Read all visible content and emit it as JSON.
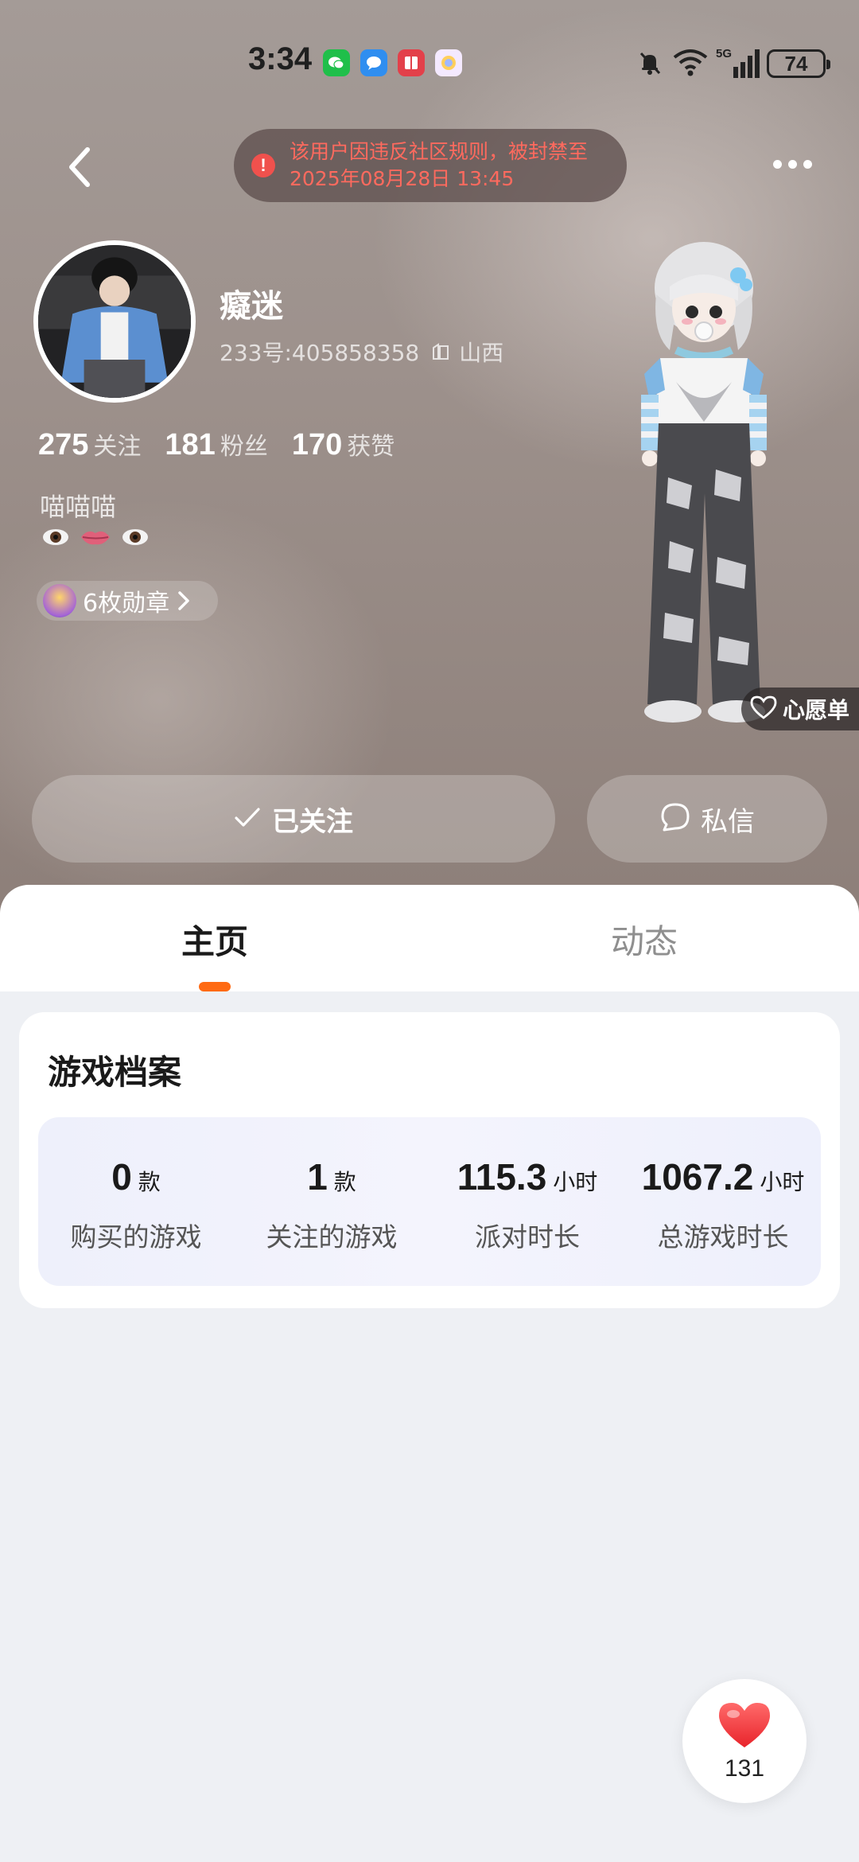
{
  "status_bar": {
    "time": "3:34",
    "network": "5G",
    "battery": "74"
  },
  "header": {
    "ban_notice_line1": "该用户因违反社区规则，被封禁至",
    "ban_notice_line2": "2025年08月28日 13:45"
  },
  "profile": {
    "username": "癡迷",
    "id_text": "233号:405858358",
    "location": "山西",
    "stats": [
      {
        "value": "275",
        "label": "关注"
      },
      {
        "value": "181",
        "label": "粉丝"
      },
      {
        "value": "170",
        "label": "获赞"
      }
    ],
    "bio": "喵喵喵",
    "medals": "6枚勋章",
    "wishlist": "心愿单"
  },
  "actions": {
    "follow": "已关注",
    "message": "私信"
  },
  "tabs": {
    "home": "主页",
    "feed": "动态"
  },
  "game_profile": {
    "title": "游戏档案",
    "stats": [
      {
        "value": "0",
        "unit": "款",
        "label": "购买的游戏"
      },
      {
        "value": "1",
        "unit": "款",
        "label": "关注的游戏"
      },
      {
        "value": "115.3",
        "unit": "小时",
        "label": "派对时长"
      },
      {
        "value": "1067.2",
        "unit": "小时",
        "label": "总游戏时长"
      }
    ]
  },
  "like": {
    "count": "131"
  },
  "colors": {
    "accent": "#ff6a13",
    "warning": "#f0514d",
    "like": "#f3393c"
  }
}
